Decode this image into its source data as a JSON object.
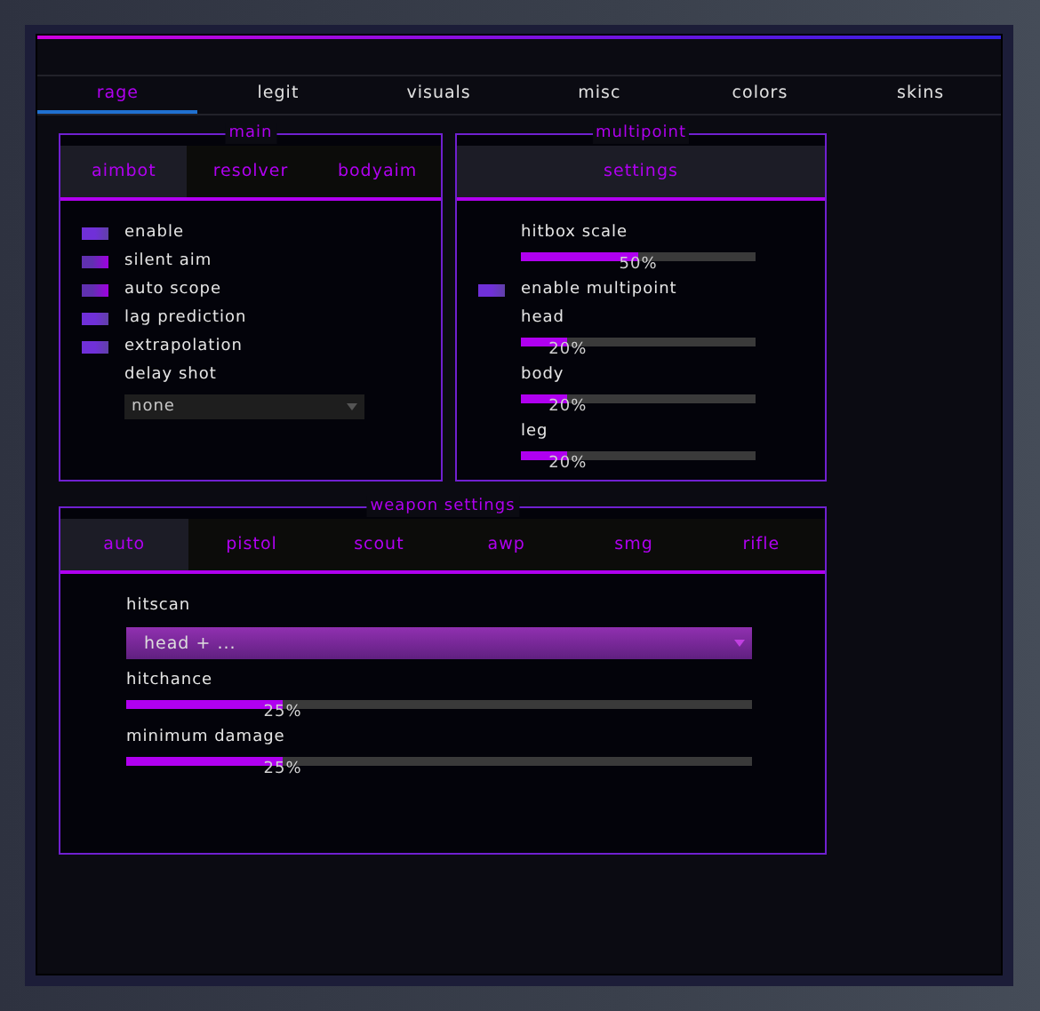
{
  "tabs": [
    {
      "label": "rage",
      "selected": true
    },
    {
      "label": "legit",
      "selected": false
    },
    {
      "label": "visuals",
      "selected": false
    },
    {
      "label": "misc",
      "selected": false
    },
    {
      "label": "colors",
      "selected": false
    },
    {
      "label": "skins",
      "selected": false
    }
  ],
  "main": {
    "title": "main",
    "subtabs": [
      {
        "label": "aimbot",
        "selected": true
      },
      {
        "label": "resolver",
        "selected": false
      },
      {
        "label": "bodyaim",
        "selected": false
      }
    ],
    "items": [
      {
        "kind": "checkbox",
        "label": "enable",
        "checked": true,
        "hovered": false
      },
      {
        "kind": "checkbox",
        "label": "silent aim",
        "checked": true,
        "hovered": true
      },
      {
        "kind": "checkbox",
        "label": "auto scope",
        "checked": true,
        "hovered": true
      },
      {
        "kind": "checkbox",
        "label": "lag prediction",
        "checked": true,
        "hovered": false
      },
      {
        "kind": "checkbox",
        "label": "extrapolation",
        "checked": true,
        "hovered": false
      },
      {
        "kind": "dropdown",
        "label": "delay shot",
        "value": "none"
      }
    ]
  },
  "multipoint": {
    "title": "multipoint",
    "subtabs": [
      {
        "label": "settings",
        "selected": true
      }
    ],
    "items": [
      {
        "kind": "slider",
        "label": "hitbox scale",
        "level": 0.5,
        "reading": "50%"
      },
      {
        "kind": "checkbox",
        "label": "enable multipoint",
        "checked": true,
        "hovered": false
      },
      {
        "kind": "slider",
        "label": "head",
        "level": 0.2,
        "reading": "20%"
      },
      {
        "kind": "slider",
        "label": "body",
        "level": 0.2,
        "reading": "20%"
      },
      {
        "kind": "slider",
        "label": "leg",
        "level": 0.2,
        "reading": "20%"
      }
    ]
  },
  "weapon_settings": {
    "title": "weapon settings",
    "subtabs": [
      {
        "label": "auto",
        "selected": true
      },
      {
        "label": "pistol",
        "selected": false
      },
      {
        "label": "scout",
        "selected": false
      },
      {
        "label": "awp",
        "selected": false
      },
      {
        "label": "smg",
        "selected": false
      },
      {
        "label": "rifle",
        "selected": false
      }
    ],
    "items": [
      {
        "kind": "multiselect",
        "label": "hitscan",
        "value": "head + ..."
      },
      {
        "kind": "slider",
        "label": "hitchance",
        "level": 0.25,
        "reading": "25%"
      },
      {
        "kind": "slider",
        "label": "minimum damage",
        "level": 0.25,
        "reading": "25%"
      }
    ]
  }
}
